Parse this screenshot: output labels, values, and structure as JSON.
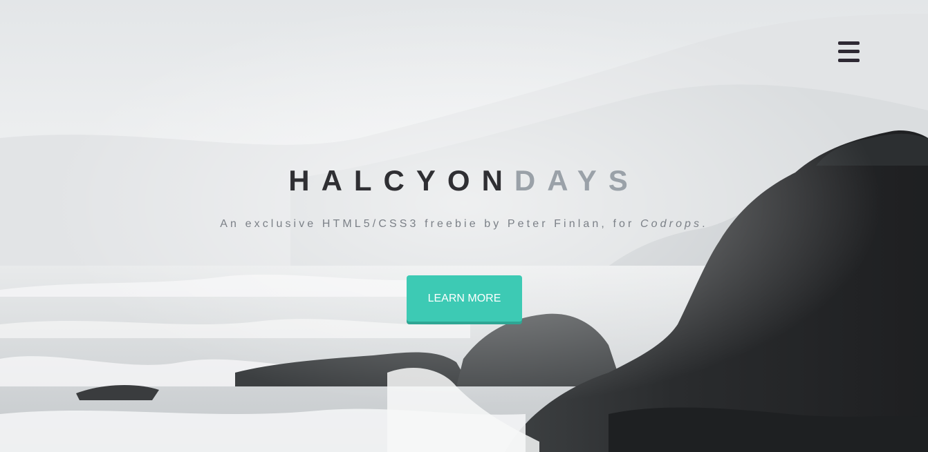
{
  "header": {
    "menu_icon": "hamburger-menu-icon"
  },
  "hero": {
    "title_part1": "HALCYON",
    "title_part2": "DAYS",
    "subtitle_text": "An exclusive HTML5/CSS3 freebie by Peter Finlan, for ",
    "subtitle_link": "Codrops",
    "subtitle_end": ".",
    "cta_label": "LEARN MORE"
  },
  "colors": {
    "accent": "#3dcab4",
    "title_dark": "#2f2f33",
    "title_light": "#9aa1a8",
    "menu_icon": "#2e2933"
  }
}
